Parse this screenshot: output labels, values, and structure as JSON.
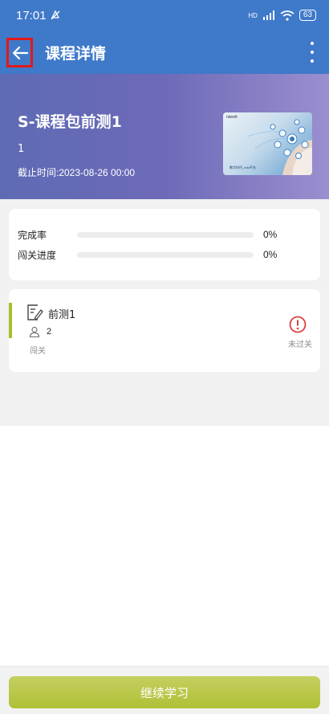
{
  "status_bar": {
    "time": "17:01",
    "network": "HD",
    "battery": "63"
  },
  "header": {
    "title": "课程详情",
    "back_icon": "arrow-left-icon",
    "menu_icon": "more-vertical-icon"
  },
  "course": {
    "title": "S-课程包前测1",
    "count": "1",
    "deadline": "截止时间:2023-08-26 00:00",
    "thumbnail": {
      "brand": "nanoit",
      "caption": "数字时代_edu平台"
    }
  },
  "progress": {
    "completion_label": "完成率",
    "completion_value": "0%",
    "completion_fraction": 0,
    "level_label": "闯关进度",
    "level_value": "0%",
    "level_fraction": 0
  },
  "lesson": {
    "name": "前测1",
    "people": "2",
    "type": "闯关",
    "status": "未过关",
    "icon": "edit-document-icon",
    "status_icon": "alert-circle-icon"
  },
  "footer": {
    "continue_label": "继续学习"
  },
  "colors": {
    "primary": "#3f79c9",
    "accent": "#a7bd3a",
    "alert": "#d94141"
  }
}
